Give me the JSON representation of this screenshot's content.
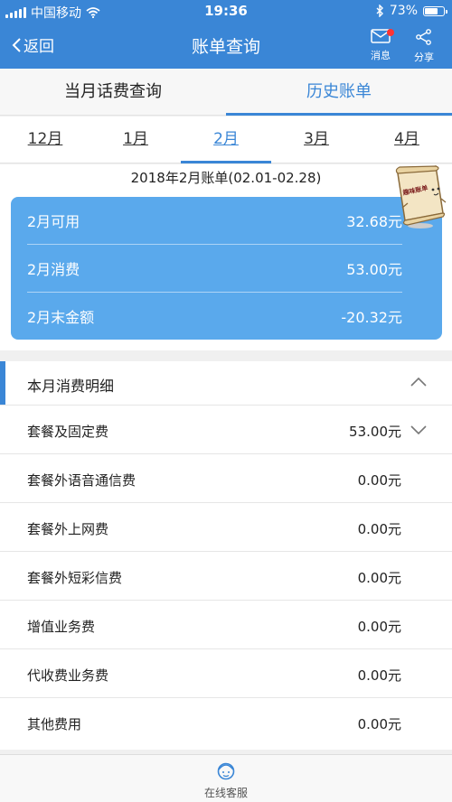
{
  "status_bar": {
    "carrier": "中国移动",
    "time": "19:36",
    "battery": "73%",
    "battery_level": 0.73
  },
  "nav": {
    "back_label": "返回",
    "title": "账单查询",
    "messages_label": "消息",
    "share_label": "分享"
  },
  "tabs": [
    {
      "label": "当月话费查询",
      "active": false
    },
    {
      "label": "历史账单",
      "active": true
    }
  ],
  "months": [
    {
      "label": "12月"
    },
    {
      "label": "1月"
    },
    {
      "label": "2月",
      "active": true
    },
    {
      "label": "3月"
    },
    {
      "label": "4月"
    }
  ],
  "bill": {
    "period": "2018年2月账单(02.01-02.28)",
    "summary": [
      {
        "label": "2月可用",
        "value": "32.68元"
      },
      {
        "label": "2月消费",
        "value": "53.00元"
      },
      {
        "label": "2月末金额",
        "value": "-20.32元"
      }
    ]
  },
  "sticker": {
    "text": "趣味账单"
  },
  "details": {
    "title": "本月消费明细",
    "items": [
      {
        "label": "套餐及固定费",
        "value": "53.00元"
      },
      {
        "label": "套餐外语音通信费",
        "value": "0.00元"
      },
      {
        "label": "套餐外上网费",
        "value": "0.00元"
      },
      {
        "label": "套餐外短彩信费",
        "value": "0.00元"
      },
      {
        "label": "增值业务费",
        "value": "0.00元"
      },
      {
        "label": "代收费业务费",
        "value": "0.00元"
      },
      {
        "label": "其他费用",
        "value": "0.00元"
      }
    ]
  },
  "bottom": {
    "service_label": "在线客服"
  },
  "colors": {
    "accent": "#3a86d6",
    "card": "#5aa9ec",
    "badge": "#ff3333"
  }
}
